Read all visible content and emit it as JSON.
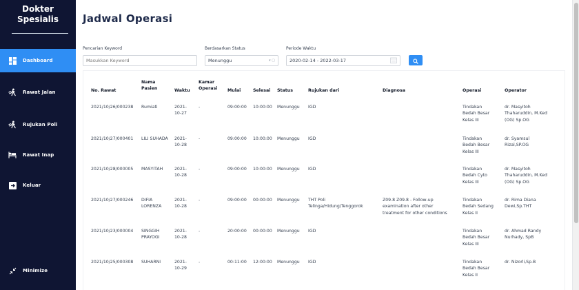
{
  "sidebar": {
    "brand_line1": "Dokter",
    "brand_line2": "Spesialis",
    "items": [
      {
        "label": "Dashboard",
        "icon": "dashboard-icon",
        "active": true
      },
      {
        "label": "Rawat Jalan",
        "icon": "walking-person-icon"
      },
      {
        "label": "Rujukan Poli",
        "icon": "walking-person-icon"
      },
      {
        "label": "Rawat Inap",
        "icon": "hospital-bed-icon"
      },
      {
        "label": "Keluar",
        "icon": "logout-icon"
      }
    ],
    "minimize_label": "Minimize"
  },
  "main": {
    "title": "Jadwal Operasi",
    "filters": {
      "keyword_label": "Pencarian Keyword",
      "keyword_placeholder": "Masukkan Keyword",
      "status_label": "Berdasarkan Status",
      "status_value": "Menunggu",
      "period_label": "Periode Waktu",
      "period_value": "2020-02-14 - 2022-03-17"
    },
    "table": {
      "headers": {
        "no_rawat": "No. Rawat",
        "nama_pasien_1": "Nama",
        "nama_pasien_2": "Pasien",
        "waktu": "Waktu",
        "kamar_operasi_1": "Kamar",
        "kamar_operasi_2": "Operasi",
        "mulai": "Mulai",
        "selesai": "Selesai",
        "status": "Status",
        "rujukan_dari": "Rujukan dari",
        "diagnosa": "Diagnosa",
        "operasi": "Operasi",
        "operator": "Operator"
      },
      "rows": [
        {
          "no_rawat": "2021/10/26/000238",
          "nama": [
            "Rumiati"
          ],
          "waktu": [
            "2021-",
            "10-27"
          ],
          "kamar": "-",
          "mulai": "09:00:00",
          "selesai": "10:00:00",
          "status": "Menunggu",
          "rujukan": [
            "IGD"
          ],
          "diagnosa": [],
          "operasi": [
            "Tindakan",
            "Bedah Besar",
            "Kelas III"
          ],
          "operator": [
            "dr. Masyitoh",
            "Thaharuddin, M.Ked",
            "(OG) Sp.OG"
          ]
        },
        {
          "no_rawat": "2021/10/27/000401",
          "nama": [
            "LILI SUHADA"
          ],
          "waktu": [
            "2021-",
            "10-28"
          ],
          "kamar": "-",
          "mulai": "09:00:00",
          "selesai": "10:00:00",
          "status": "Menunggu",
          "rujukan": [
            "IGD"
          ],
          "diagnosa": [],
          "operasi": [
            "Tindakan",
            "Bedah Besar",
            "Kelas III"
          ],
          "operator": [
            "dr. Syamsul",
            "Rizal,SP.OG"
          ]
        },
        {
          "no_rawat": "2021/10/28/000005",
          "nama": [
            "MASYITAH"
          ],
          "waktu": [
            "2021-",
            "10-28"
          ],
          "kamar": "-",
          "mulai": "09:00:00",
          "selesai": "10:00:00",
          "status": "Menunggu",
          "rujukan": [
            "IGD"
          ],
          "diagnosa": [],
          "operasi": [
            "Tindakan",
            "Bedah Cyto",
            "Kelas III"
          ],
          "operator": [
            "dr. Masyitoh",
            "Thaharuddin, M.Ked",
            "(OG) Sp.OG"
          ]
        },
        {
          "no_rawat": "2021/10/27/000246",
          "nama": [
            "DIFIA",
            "LORENZA"
          ],
          "waktu": [
            "2021-",
            "10-28"
          ],
          "kamar": "-",
          "mulai": "09:00:00",
          "selesai": "00:00:00",
          "status": "Menunggu",
          "rujukan": [
            "THT Poli",
            "Telinga/Hidung/Tenggorok"
          ],
          "diagnosa": [
            "Z09.8 Z09.8 - Follow-up",
            "examination after other",
            "treatment for other conditions"
          ],
          "operasi": [
            "Tindakan",
            "Bedah Sedang",
            "Kelas II"
          ],
          "operator": [
            "dr. Rima Diana",
            "Dewi,Sp.THT"
          ]
        },
        {
          "no_rawat": "2021/10/23/000004",
          "nama": [
            "SINGGIH",
            "PRAYOGI"
          ],
          "waktu": [
            "2021-",
            "10-28"
          ],
          "kamar": "-",
          "mulai": "20:00:00",
          "selesai": "00:00:00",
          "status": "Menunggu",
          "rujukan": [
            "IGD"
          ],
          "diagnosa": [],
          "operasi": [
            "Tindakan",
            "Bedah Besar",
            "Kelas III"
          ],
          "operator": [
            "dr. Ahmad Randy",
            "Nurhady, SpB"
          ]
        },
        {
          "no_rawat": "2021/10/25/000308",
          "nama": [
            "SUHARNI"
          ],
          "waktu": [
            "2021-",
            "10-29"
          ],
          "kamar": "-",
          "mulai": "00:11:00",
          "selesai": "12:00:00",
          "status": "Menunggu",
          "rujukan": [
            "IGD"
          ],
          "diagnosa": [],
          "operasi": [
            "Tindakan",
            "Bedah Besar",
            "Kelas II"
          ],
          "operator": [
            "dr. Nizorli,Sp.B"
          ]
        }
      ]
    }
  },
  "colors": {
    "sidebar_bg": "#0f1533",
    "accent": "#2f8ef4",
    "title": "#1e2a4a"
  }
}
